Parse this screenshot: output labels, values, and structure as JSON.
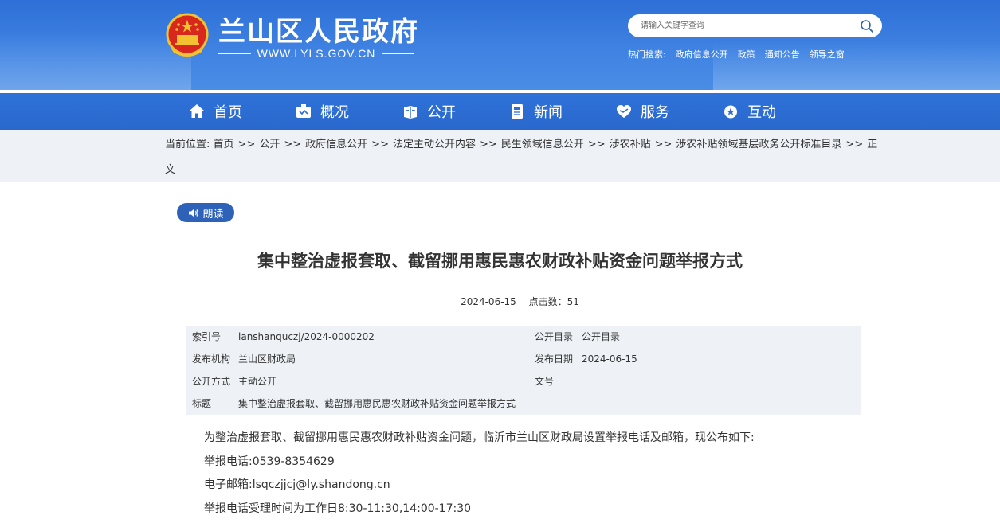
{
  "header": {
    "site_title": "兰山区人民政府",
    "site_url": "WWW.LYLS.GOV.CN",
    "search_placeholder": "请输入关键字查询",
    "hot_label": "热门搜索:",
    "hot_items": [
      "政府信息公开",
      "政策",
      "通知公告",
      "领导之窗"
    ]
  },
  "nav": {
    "items": [
      {
        "label": "首页",
        "icon": "home-icon"
      },
      {
        "label": "概况",
        "icon": "overview-icon"
      },
      {
        "label": "公开",
        "icon": "open-icon"
      },
      {
        "label": "新闻",
        "icon": "news-icon"
      },
      {
        "label": "服务",
        "icon": "service-icon"
      },
      {
        "label": "互动",
        "icon": "interact-icon"
      }
    ]
  },
  "breadcrumb": {
    "prefix": "当前位置:",
    "items": [
      "首页",
      "公开",
      "政府信息公开",
      "法定主动公开内容",
      "民生领域信息公开",
      "涉农补贴",
      "涉农补贴领域基层政务公开标准目录",
      "正文"
    ],
    "separator": ">>"
  },
  "read_button": {
    "label": "朗读"
  },
  "article": {
    "title": "集中整治虚报套取、截留挪用惠民惠农财政补贴资金问题举报方式",
    "date": "2024-06-15",
    "clicks": "点击数：51"
  },
  "info": {
    "index_label": "索引号",
    "index_value": "lanshanquczj/2024-0000202",
    "catalog_label": "公开目录",
    "catalog_value": "公开目录",
    "publisher_label": "发布机构",
    "publisher_value": "兰山区财政局",
    "pubdate_label": "发布日期",
    "pubdate_value": "2024-06-15",
    "mode_label": "公开方式",
    "mode_value": "主动公开",
    "docno_label": "文号",
    "docno_value": "",
    "subject_label": "标题",
    "subject_value": "集中整治虚报套取、截留挪用惠民惠农财政补贴资金问题举报方式"
  },
  "body": {
    "p1": "为整治虚报套取、截留挪用惠民惠农财政补贴资金问题，临沂市兰山区财政局设置举报电话及邮箱，现公布如下:",
    "p2": "举报电话:0539-8354629",
    "p3": "电子邮箱:lsqczjjcj@ly.shandong.cn",
    "p4": "举报电话受理时间为工作日8:30-11:30,14:00-17:30"
  },
  "colors": {
    "header_blue": "#3a7de0",
    "nav_blue": "#2d6dd5",
    "read_btn": "#2d62b8",
    "band_gray": "#eef2f6"
  }
}
